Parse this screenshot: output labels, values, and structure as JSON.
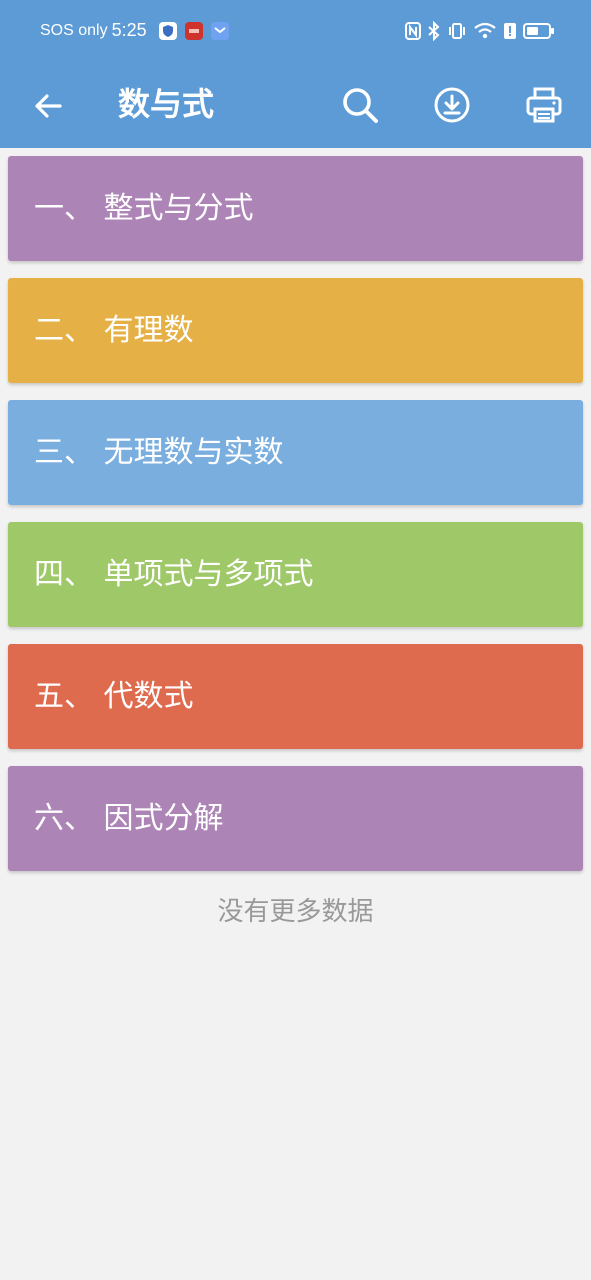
{
  "status_bar": {
    "carrier": "SOS only",
    "time": "5:25",
    "battery_level_percent": 55,
    "icons": [
      "shield-app-icon",
      "red-app-icon",
      "mail-app-icon",
      "nfc-icon",
      "bluetooth-icon",
      "vibrate-icon",
      "wifi-icon",
      "alert-icon",
      "battery-icon"
    ]
  },
  "app_bar": {
    "title": "数与式",
    "background_color": "#5c9bd6",
    "actions": [
      "back-arrow-icon",
      "search-icon",
      "download-icon",
      "print-icon"
    ]
  },
  "chapters": [
    {
      "label": "一、 整式与分式",
      "color": "#ad84b6"
    },
    {
      "label": "二、 有理数",
      "color": "#e5b045"
    },
    {
      "label": "三、 无理数与实数",
      "color": "#7aaede"
    },
    {
      "label": "四、 单项式与多项式",
      "color": "#9fc869"
    },
    {
      "label": "五、 代数式",
      "color": "#df6b4f"
    },
    {
      "label": "六、 因式分解",
      "color": "#ad84b6"
    }
  ],
  "footer": {
    "no_more_text": "没有更多数据"
  }
}
